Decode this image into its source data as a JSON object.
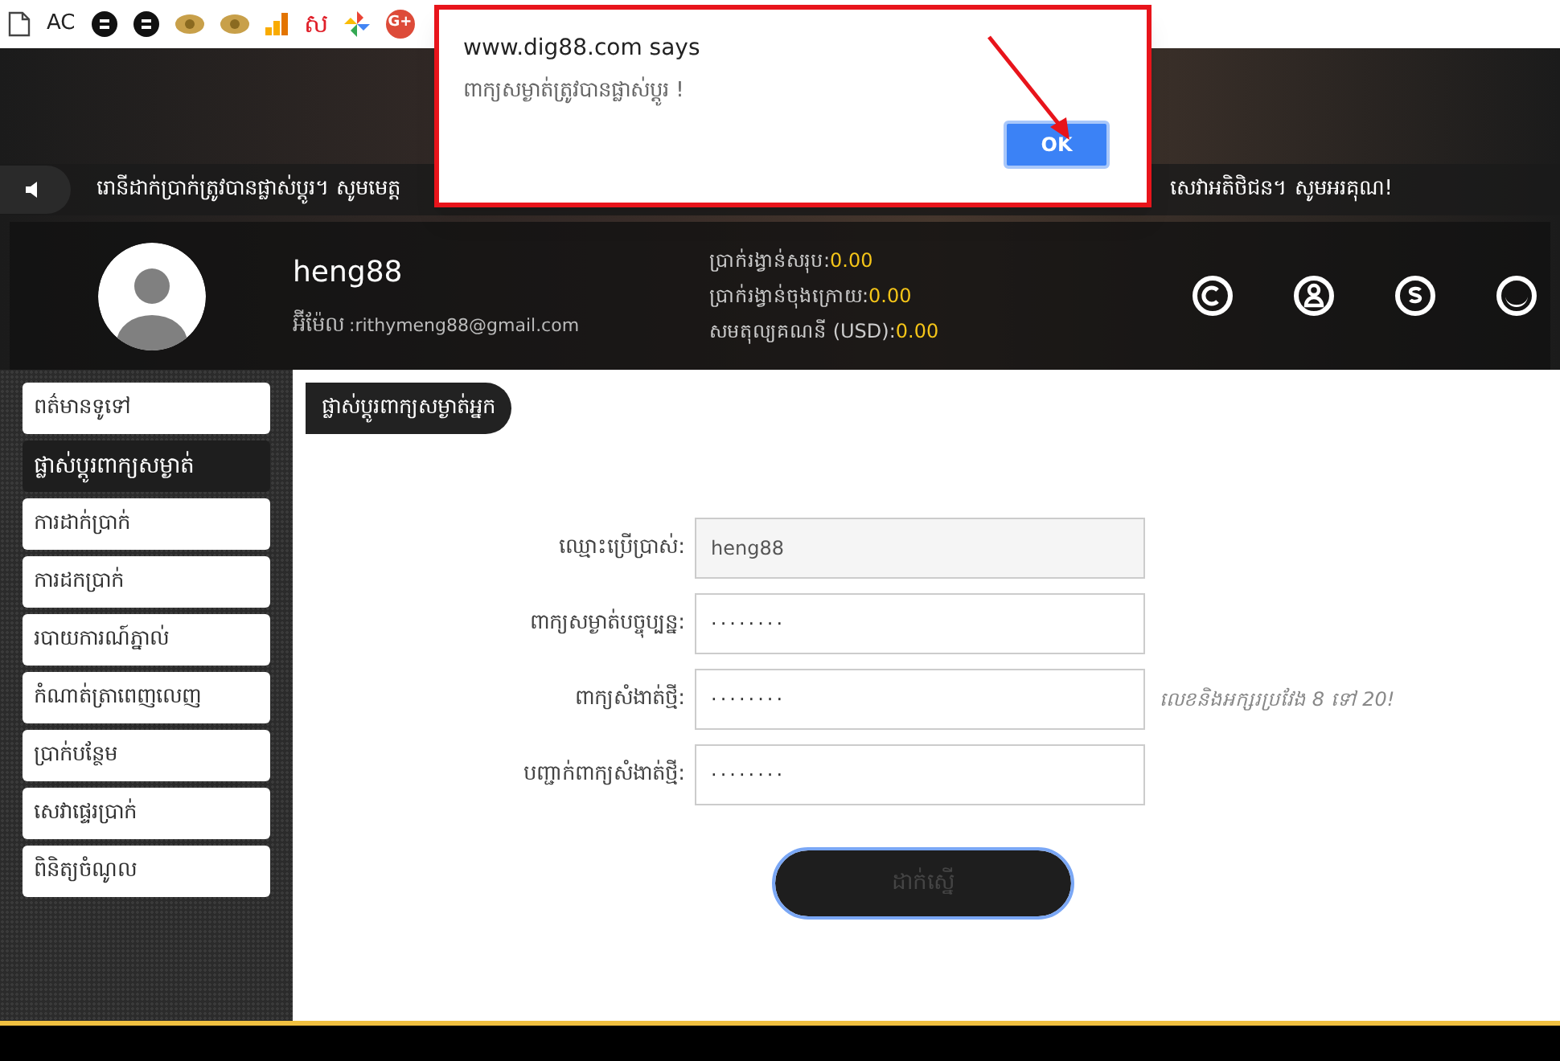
{
  "bookmarks": [
    {
      "kind": "page"
    },
    {
      "kind": "text",
      "label": "AC"
    },
    {
      "kind": "dark"
    },
    {
      "kind": "dark"
    },
    {
      "kind": "gold"
    },
    {
      "kind": "gold"
    },
    {
      "kind": "bars"
    },
    {
      "kind": "redtext",
      "label": "ស"
    },
    {
      "kind": "pinwheel"
    },
    {
      "kind": "gplus",
      "label": "G+"
    }
  ],
  "dialog": {
    "title": "www.dig88.com says",
    "message": "ពាក្យសម្ងាត់ត្រូវបានផ្លាស់ប្តូរ !",
    "button": "OK"
  },
  "marquee": {
    "start": "រោនីដាក់ប្រាក់ត្រូវបានផ្លាស់ប្តូរ។ សូមមេត្ត",
    "end": "សេវាអតិថិជន។ សូមអរគុណ!"
  },
  "profile": {
    "name": "heng88",
    "email_label": "អ៊ីម៉ែល",
    "email": ":rithymeng88@gmail.com",
    "balances": [
      {
        "label": "ប្រាក់រង្វាន់សរុប:",
        "value": "0.00"
      },
      {
        "label": "ប្រាក់រង្វាន់ចុងក្រោយ:",
        "value": "0.00"
      },
      {
        "label": "សមតុល្យគណនី (USD):",
        "value": "0.00"
      }
    ],
    "icons": [
      {
        "kind": "c"
      },
      {
        "kind": "person"
      },
      {
        "kind": "s"
      },
      {
        "kind": "moon"
      }
    ]
  },
  "sidebar": {
    "items": [
      {
        "label": "ពត៌មានទូទៅ",
        "selected": false
      },
      {
        "label": "ផ្លាស់ប្តូរពាក្យសម្ងាត់",
        "selected": true
      },
      {
        "label": "ការដាក់ប្រាក់",
        "selected": false
      },
      {
        "label": "ការដកប្រាក់",
        "selected": false
      },
      {
        "label": "របាយការណ៍ភ្នាល់",
        "selected": false
      },
      {
        "label": "កំណាត់ត្រាពេញលេញ",
        "selected": false
      },
      {
        "label": "ប្រាក់បន្ថែម",
        "selected": false
      },
      {
        "label": "សេវាផ្ទេរប្រាក់",
        "selected": false
      },
      {
        "label": "ពិនិត្យចំណូល",
        "selected": false
      }
    ]
  },
  "form": {
    "title": "ផ្លាស់ប្តូរពាក្យសម្ងាត់អ្នក",
    "fields": [
      {
        "label": "ឈ្មោះប្រើប្រាស់:",
        "value": "heng88",
        "disabled": true
      },
      {
        "label": "ពាក្យសម្ងាត់បច្ចុប្បន្ន:",
        "value": "········",
        "disabled": false
      },
      {
        "label": "ពាក្យសំងាត់ថ្មី:",
        "value": "········",
        "disabled": false,
        "hint": "លេខនិងអក្សរប្រវែង 8 ទៅ 20!"
      },
      {
        "label": "បញ្ជាក់ពាក្យសំងាត់ថ្មី:",
        "value": "········",
        "disabled": false
      }
    ],
    "submit": {
      "label": "ដាក់ស្នើ",
      "focused": true
    }
  }
}
